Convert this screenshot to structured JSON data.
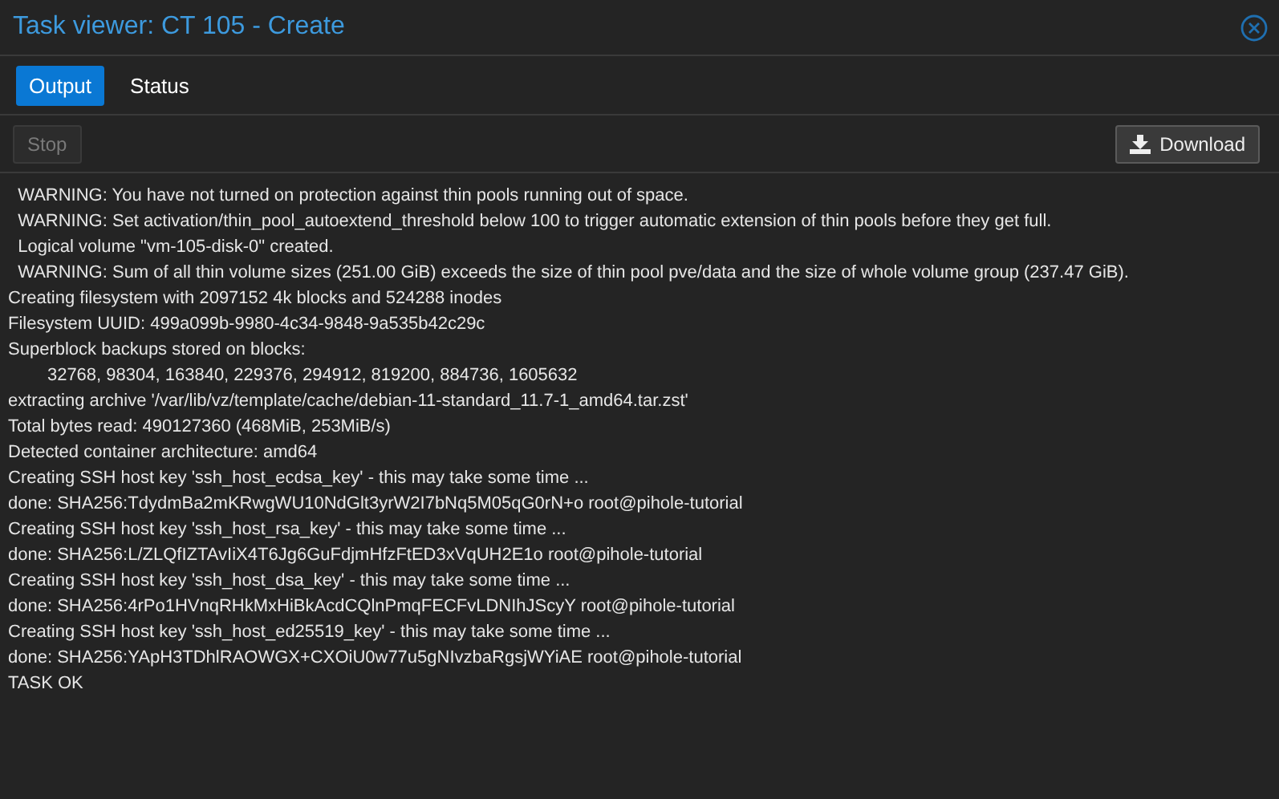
{
  "window": {
    "title": "Task viewer: CT 105 - Create"
  },
  "tabs": [
    {
      "label": "Output",
      "selected": true
    },
    {
      "label": "Status",
      "selected": false
    }
  ],
  "toolbar": {
    "buttons": [
      {
        "label": "Stop",
        "kind": "stop",
        "disabled": true
      },
      {
        "label": "Download",
        "kind": "download",
        "disabled": false
      }
    ]
  },
  "log": [
    "  WARNING: You have not turned on protection against thin pools running out of space.",
    "  WARNING: Set activation/thin_pool_autoextend_threshold below 100 to trigger automatic extension of thin pools before they get full.",
    "  Logical volume \"vm-105-disk-0\" created.",
    "  WARNING: Sum of all thin volume sizes (251.00 GiB) exceeds the size of thin pool pve/data and the size of whole volume group (237.47 GiB).",
    "Creating filesystem with 2097152 4k blocks and 524288 inodes",
    "Filesystem UUID: 499a099b-9980-4c34-9848-9a535b42c29c",
    "Superblock backups stored on blocks:",
    "\t32768, 98304, 163840, 229376, 294912, 819200, 884736, 1605632",
    "extracting archive '/var/lib/vz/template/cache/debian-11-standard_11.7-1_amd64.tar.zst'",
    "Total bytes read: 490127360 (468MiB, 253MiB/s)",
    "Detected container architecture: amd64",
    "Creating SSH host key 'ssh_host_ecdsa_key' - this may take some time ...",
    "done: SHA256:TdydmBa2mKRwgWU10NdGlt3yrW2I7bNq5M05qG0rN+o root@pihole-tutorial",
    "Creating SSH host key 'ssh_host_rsa_key' - this may take some time ...",
    "done: SHA256:L/ZLQfIZTAvIiX4T6Jg6GuFdjmHfzFtED3xVqUH2E1o root@pihole-tutorial",
    "Creating SSH host key 'ssh_host_dsa_key' - this may take some time ...",
    "done: SHA256:4rPo1HVnqRHkMxHiBkAcdCQlnPmqFECFvLDNIhJScyY root@pihole-tutorial",
    "Creating SSH host key 'ssh_host_ed25519_key' - this may take some time ...",
    "done: SHA256:YApH3TDhlRAOWGX+CXOiU0w77u5gNIvzbaRgsjWYiAE root@pihole-tutorial",
    "TASK OK"
  ]
}
